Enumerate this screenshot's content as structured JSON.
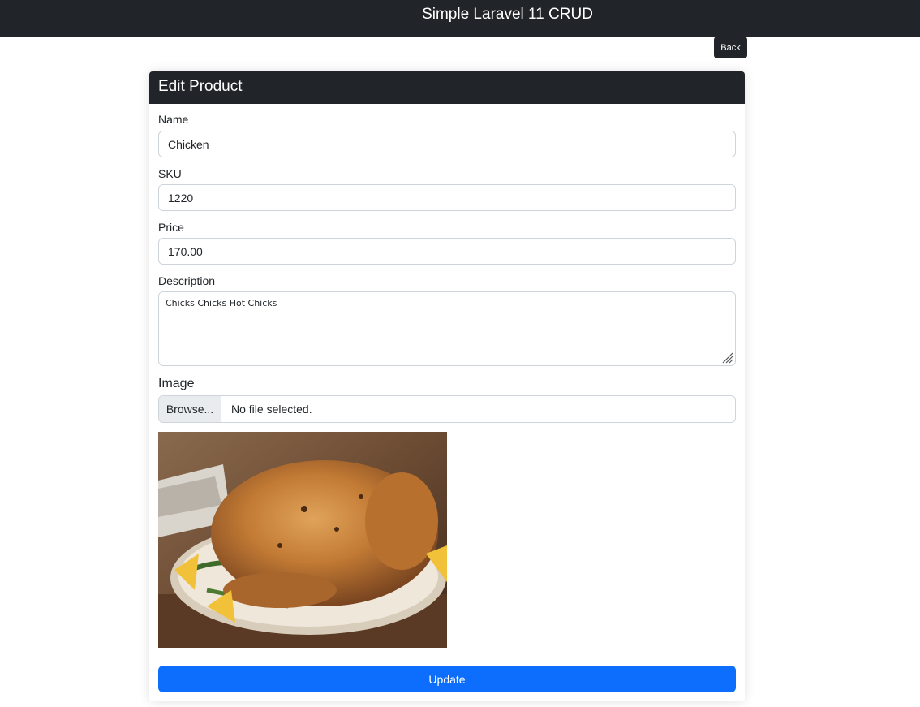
{
  "header": {
    "title": "Simple Laravel 11 CRUD"
  },
  "actions": {
    "back_label": "Back",
    "update_label": "Update"
  },
  "card": {
    "title": "Edit Product"
  },
  "form": {
    "name": {
      "label": "Name",
      "value": "Chicken"
    },
    "sku": {
      "label": "SKU",
      "value": "1220"
    },
    "price": {
      "label": "Price",
      "value": "170.00"
    },
    "description": {
      "label": "Description",
      "value": "Chicks Chicks Hot Chicks"
    },
    "image": {
      "label": "Image",
      "browse_label": "Browse...",
      "status": "No file selected."
    }
  },
  "colors": {
    "dark": "#212529",
    "primary": "#0d6efd"
  },
  "icons": {
    "resize": "resize-grip-icon"
  }
}
